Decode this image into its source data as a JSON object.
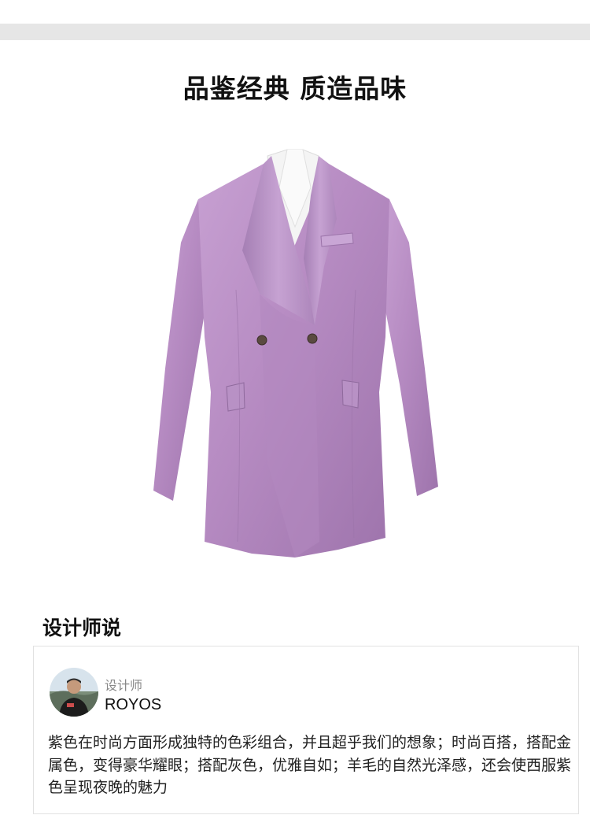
{
  "header": {
    "headline": "品鉴经典  质造品味"
  },
  "product": {
    "image_alt": "purple double-breasted blazer",
    "accent_color": "#b98fc4"
  },
  "designer_section": {
    "title": "设计师说",
    "role": "设计师",
    "name": "ROYOS",
    "quote": "紫色在时尚方面形成独特的色彩组合，并且超乎我们的想象；时尚百搭，搭配金属色，变得豪华耀眼；搭配灰色，优雅自如；羊毛的自然光泽感，还会使西服紫色呈现夜晚的魅力"
  }
}
